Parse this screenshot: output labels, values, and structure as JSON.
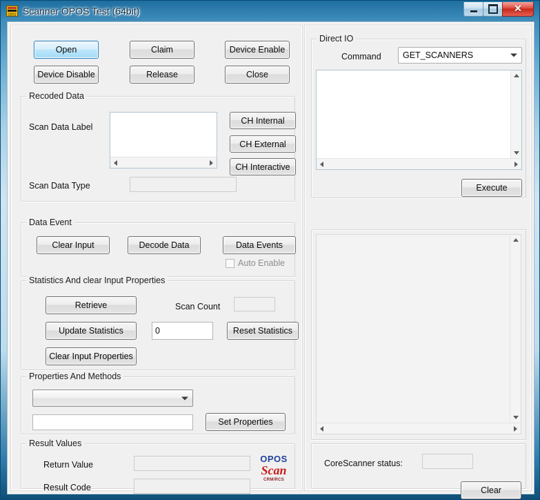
{
  "window": {
    "title": "Scanner OPOS Test (64bit)",
    "icon": "opos-app-icon",
    "controls": {
      "minimize": "–",
      "maximize": "□",
      "close": "✕"
    },
    "accent_color": "#3c7fb1",
    "close_color": "#c9291b"
  },
  "device_buttons": {
    "open": "Open",
    "claim": "Claim",
    "device_enable": "Device Enable",
    "device_disable": "Device Disable",
    "release": "Release",
    "close": "Close"
  },
  "recoded_data": {
    "title": "Recoded Data",
    "scan_data_label": "Scan Data Label",
    "scan_data_label_value": "",
    "scan_data_type": "Scan Data Type",
    "scan_data_type_value": "",
    "ch_internal": "CH Internal",
    "ch_external": "CH External",
    "ch_interactive": "CH Interactive"
  },
  "data_event": {
    "title": "Data Event",
    "clear_input": "Clear Input",
    "decode_data": "Decode Data",
    "data_events": "Data Events",
    "auto_enable": "Auto Enable",
    "auto_enable_checked": false,
    "auto_enable_disabled": true
  },
  "statistics": {
    "title": "Statistics And  clear Input Properties",
    "retrieve": "Retrieve",
    "update_statistics": "Update Statistics",
    "clear_input_properties": "Clear Input Properties",
    "scan_count_label": "Scan Count",
    "scan_count_value": "",
    "stat_value": "0",
    "reset_statistics": "Reset Statistics"
  },
  "properties_methods": {
    "title": "Properties And Methods",
    "property_selected": "",
    "property_value": "",
    "set_properties": "Set Properties"
  },
  "result_values": {
    "title": "Result Values",
    "return_value_label": "Return Value",
    "return_value": "",
    "result_code_label": "Result Code",
    "result_code": "",
    "logo": {
      "line1": "OPOS",
      "line2": "Scan",
      "line3": "CRM/RCS",
      "line1_color": "#1f3f9c",
      "line2_color": "#cc1b1b",
      "line3_color": "#8b1a1a"
    }
  },
  "direct_io": {
    "title": "Direct IO",
    "command_label": "Command",
    "command_value": "GET_SCANNERS",
    "input_text": "",
    "execute": "Execute"
  },
  "output_panel": {
    "output_text": ""
  },
  "status_panel": {
    "corescanner_status_label": "CoreScanner status:",
    "corescanner_status_value": "",
    "clear": "Clear"
  }
}
